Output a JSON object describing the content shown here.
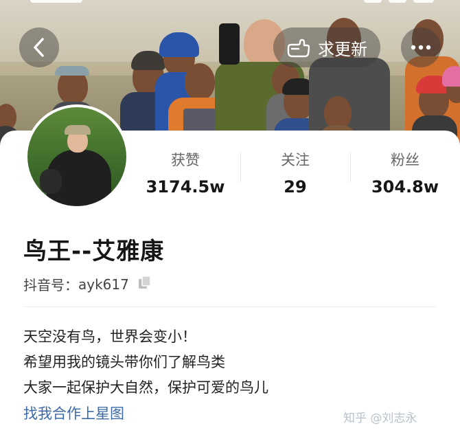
{
  "header": {
    "update_label": "求更新"
  },
  "profile": {
    "name": "鸟王--艾雅康",
    "douyin_id_label": "抖音号：",
    "douyin_id": "ayk617"
  },
  "stats": [
    {
      "label": "获赞",
      "value": "3174.5w"
    },
    {
      "label": "关注",
      "value": "29"
    },
    {
      "label": "粉丝",
      "value": "304.8w"
    }
  ],
  "bio": [
    "天空没有鸟，世界会变小！",
    "希望用我的镜头带你们了解鸟类",
    "大家一起保护大自然，保护可爱的鸟儿"
  ],
  "starmap_link": "找我合作上星图",
  "watermark": "知乎 @刘志永",
  "icons": {
    "back": "chevron-left-icon",
    "update": "hand-point-icon",
    "more": "more-dots-icon",
    "copy": "copy-icon"
  },
  "colors": {
    "link": "#3c6aa8",
    "text_primary": "#161616",
    "text_secondary": "#666666"
  }
}
